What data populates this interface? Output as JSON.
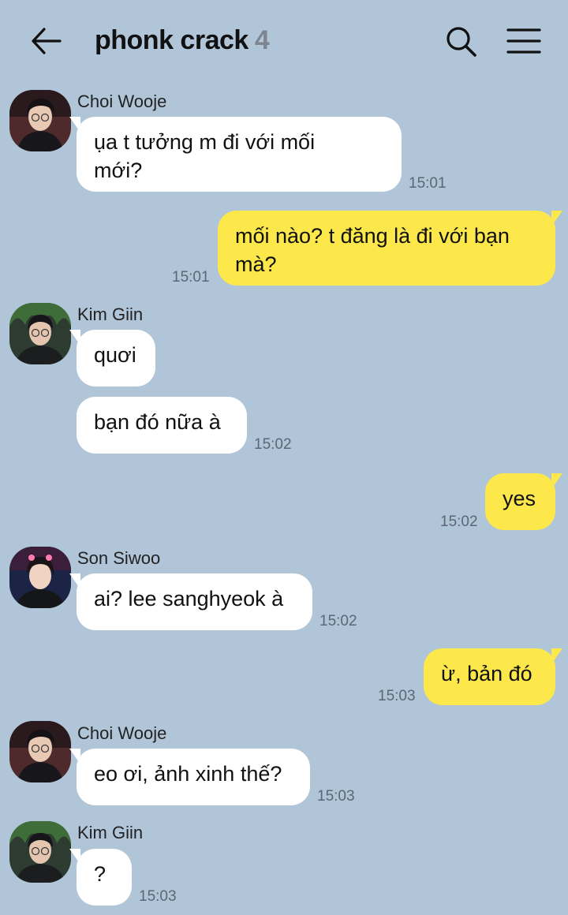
{
  "header": {
    "title": "phonk crack",
    "member_count": "4",
    "back_icon": "arrow-left-icon",
    "search_icon": "search-icon",
    "menu_icon": "hamburger-menu-icon"
  },
  "messages": [
    {
      "sender": "Choi Wooje",
      "text_lines": [
        "ụa t tưởng m đi với mối",
        "mới?"
      ],
      "time": "15:01",
      "direction": "incoming"
    },
    {
      "text_lines": [
        "mối nào? t đăng là đi với bạn",
        "mà?"
      ],
      "time": "15:01",
      "direction": "outgoing"
    },
    {
      "sender": "Kim Giin",
      "text": "quơi",
      "direction": "incoming"
    },
    {
      "text": "bạn đó nữa à",
      "time": "15:02",
      "direction": "incoming"
    },
    {
      "text": "yes",
      "time": "15:02",
      "direction": "outgoing"
    },
    {
      "sender": "Son Siwoo",
      "text": "ai? lee sanghyeok à",
      "time": "15:02",
      "direction": "incoming"
    },
    {
      "text": "ừ, bản đó",
      "time": "15:03",
      "direction": "outgoing"
    },
    {
      "sender": "Choi Wooje",
      "text": "eo ơi, ảnh xinh thế?",
      "time": "15:03",
      "direction": "incoming"
    },
    {
      "sender": "Kim Giin",
      "text": "?",
      "time": "15:03",
      "direction": "incoming"
    }
  ],
  "colors": {
    "background": "#b1c5d9",
    "incoming_bubble": "#ffffff",
    "outgoing_bubble": "#fce84a",
    "timestamp": "#5b6775"
  }
}
